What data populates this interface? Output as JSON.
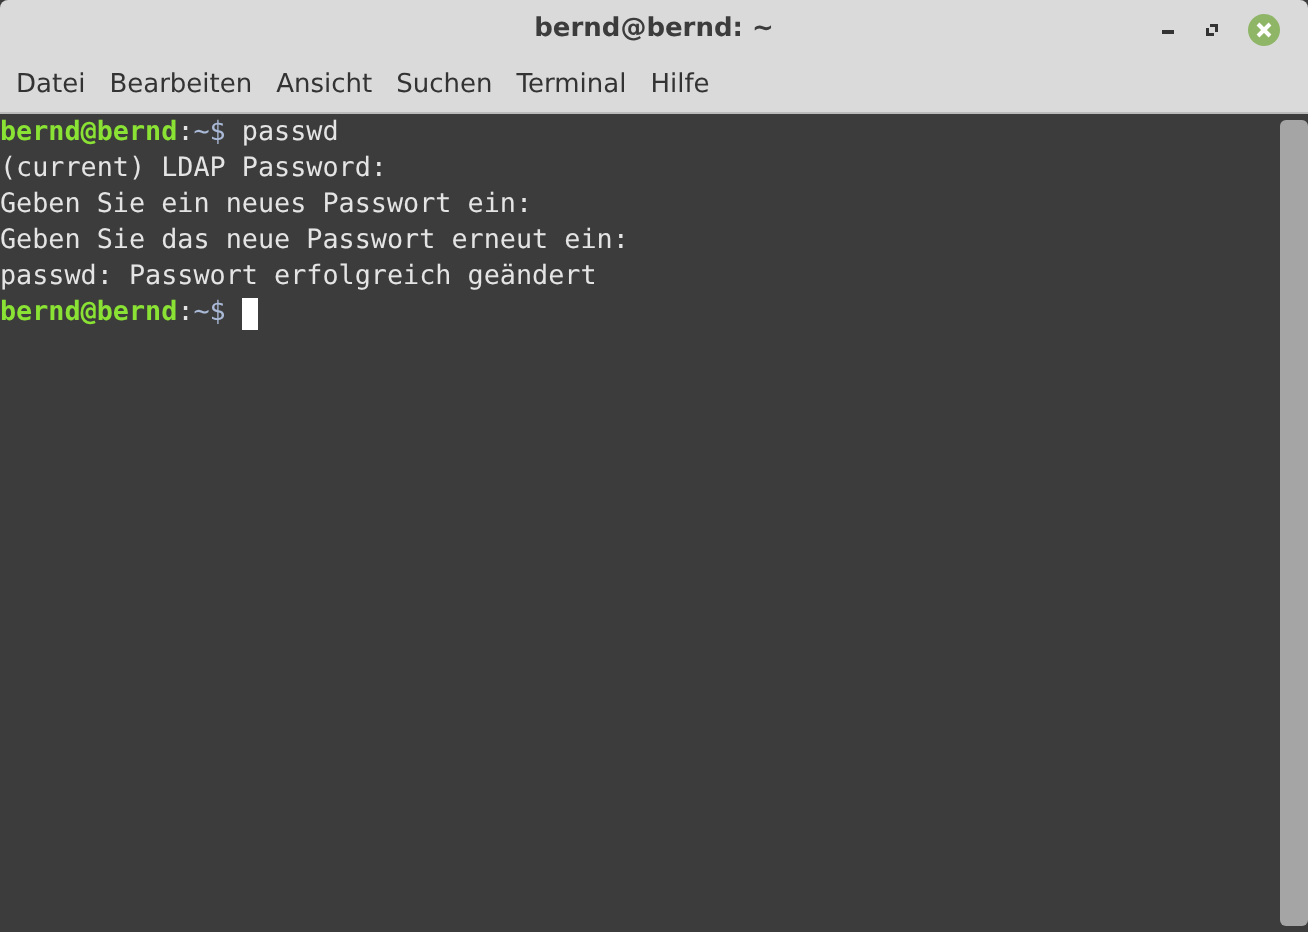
{
  "window": {
    "title": "bernd@bernd: ~"
  },
  "menu": [
    "Datei",
    "Bearbeiten",
    "Ansicht",
    "Suchen",
    "Terminal",
    "Hilfe"
  ],
  "terminal": {
    "lines": [
      {
        "kind": "prompt",
        "user": "bernd@bernd",
        "sep": ":",
        "path": "~$",
        "command": "passwd",
        "cursor": false
      },
      {
        "kind": "output",
        "text": "(current) LDAP Password:"
      },
      {
        "kind": "output",
        "text": "Geben Sie ein neues Passwort ein:"
      },
      {
        "kind": "output",
        "text": "Geben Sie das neue Passwort erneut ein:"
      },
      {
        "kind": "output",
        "text": "passwd: Passwort erfolgreich geändert"
      },
      {
        "kind": "prompt",
        "user": "bernd@bernd",
        "sep": ":",
        "path": "~$",
        "cursor": true
      }
    ]
  }
}
